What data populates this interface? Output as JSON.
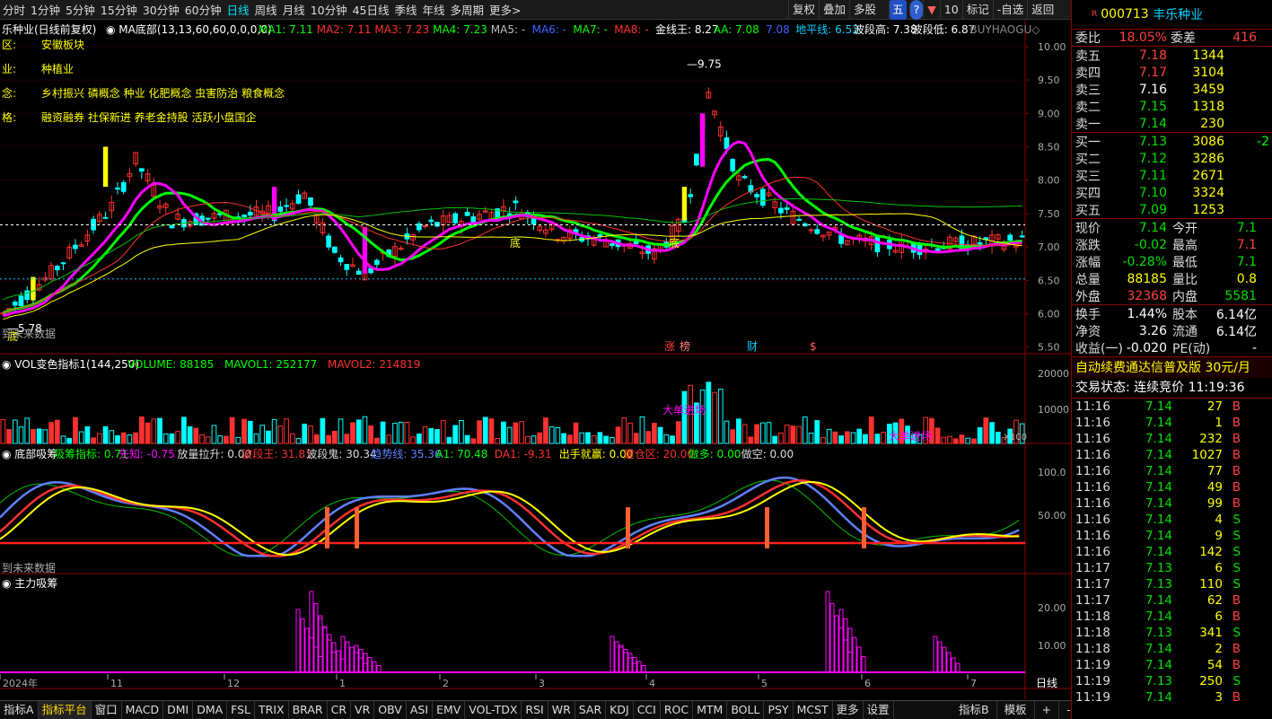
{
  "toolbar": {
    "periods": [
      "分时",
      "1分钟",
      "5分钟",
      "15分钟",
      "30分钟",
      "60分钟",
      "日线",
      "周线",
      "月线",
      "10分钟",
      "45日线",
      "季线",
      "年线",
      "多周期",
      "更多>"
    ],
    "active": "日线",
    "right": [
      "复权",
      "叠加",
      "多股"
    ],
    "num": "10",
    "mark": "标记",
    "self_sel": "-自选",
    "back": "返回"
  },
  "info": {
    "region_k": "区:",
    "region": "安徽板块",
    "industry_k": "业:",
    "industry": "种植业",
    "concept_k": "念:",
    "concept": "乡村振兴 磷概念 种业 化肥概念 虫害防治 粮食概念",
    "style_k": "格:",
    "style": "融资融券 社保新进 养老金持股 活跃小盘国企"
  },
  "main": {
    "title": "乐种业(日线前复权)",
    "ma_title": "MA底部(13,13,60,60,0,0,0,0)",
    "ma": [
      {
        "k": "MA1: 7.11",
        "c": "#00ff00"
      },
      {
        "k": "MA2: 7.11",
        "c": "#ff3030"
      },
      {
        "k": "MA3: 7.23",
        "c": "#ff3030"
      },
      {
        "k": "MA4: 7.23",
        "c": "#00ff00"
      },
      {
        "k": "MA5: -",
        "c": "#c0c0c0"
      },
      {
        "k": "MA6: -",
        "c": "#4060ff"
      },
      {
        "k": "MA7: -",
        "c": "#00ff00"
      },
      {
        "k": "MA8: -",
        "c": "#ff3030"
      },
      {
        "k": "金线王: 8.27",
        "c": "#ffffff"
      },
      {
        "k": "AA: 7.08",
        "c": "#00ff00"
      },
      {
        "k": "7.08",
        "c": "#4060ff"
      },
      {
        "k": "地平线: 6.52",
        "c": "#00d0ff"
      },
      {
        "k": "波段高: 7.38",
        "c": "#fff"
      },
      {
        "k": "波段低: 6.87",
        "c": "#fff"
      },
      {
        "k": "BUYHAOGU◇",
        "c": "#888"
      }
    ],
    "y_labels": [
      "10.00",
      "9.50",
      "9.00",
      "8.50",
      "8.00",
      "7.50",
      "7.00",
      "6.50",
      "6.00",
      "5.50"
    ],
    "high_label": "9.75",
    "low_label": "5.78",
    "future": "到未来数据",
    "di": "底",
    "events": [
      "涨",
      "榜",
      "财",
      "$"
    ]
  },
  "vol": {
    "title": "VOL变色指标1(144,250)",
    "v": "VOLUME: 88185",
    "m1": "MAVOL1: 252177",
    "m2": "MAVOL2: 214819",
    "y": [
      "20000",
      "10000"
    ],
    "x100": "X100",
    "big": "大单进场"
  },
  "ind": {
    "title": "底部吸筹",
    "items": [
      {
        "k": "吸筹指标: 0.71",
        "c": "#00ff00"
      },
      {
        "k": "先知: -0.75",
        "c": "#ff00ff"
      },
      {
        "k": "放量拉升: 0.00",
        "c": "#ddd"
      },
      {
        "k": "波段王: 31.81",
        "c": "#ff3030"
      },
      {
        "k": "波段鬼: 30.34",
        "c": "#ddd"
      },
      {
        "k": "趋势线: 35.36",
        "c": "#6080ff"
      },
      {
        "k": "A1: 70.48",
        "c": "#00ff00"
      },
      {
        "k": "DA1: -9.31",
        "c": "#ff3030"
      },
      {
        "k": "出手就赢: 0.00",
        "c": "#ffff00"
      },
      {
        "k": "建仓区: 20.00",
        "c": "#ff3030"
      },
      {
        "k": "做多: 0.00",
        "c": "#00ff00"
      },
      {
        "k": "做空: 0.00",
        "c": "#ddd"
      }
    ],
    "y": [
      "100.0",
      "50.00"
    ],
    "future": "到未来数据"
  },
  "main_chip": {
    "title": "主力吸筹",
    "y": [
      "20.00",
      "10.00"
    ],
    "x_dates": [
      "2024年",
      "11",
      "12",
      "1",
      "2",
      "3",
      "4",
      "5",
      "6",
      "7"
    ],
    "period": "日线"
  },
  "bottom": {
    "tabs": [
      "指标A",
      "指标平台",
      "窗口",
      "MACD",
      "DMI",
      "DMA",
      "FSL",
      "TRIX",
      "BRAR",
      "CR",
      "VR",
      "OBV",
      "ASI",
      "EMV",
      "VOL-TDX",
      "RSI",
      "WR",
      "SAR",
      "KDJ",
      "CCI",
      "ROC",
      "MTM",
      "BOLL",
      "PSY",
      "MCST",
      "更多",
      "设置"
    ],
    "active": "指标平台",
    "right": [
      "指标B",
      "模板",
      "+",
      "-"
    ]
  },
  "quote": {
    "code": "000713",
    "name": "丰乐种业",
    "wb_k": "委比",
    "wb": "18.05%",
    "wc_k": "委差",
    "wc": "416",
    "asks": [
      {
        "k": "卖五",
        "p": "7.18",
        "v": "1344",
        "pc": "red"
      },
      {
        "k": "卖四",
        "p": "7.17",
        "v": "3104",
        "pc": "red"
      },
      {
        "k": "卖三",
        "p": "7.16",
        "v": "3459",
        "pc": "wht"
      },
      {
        "k": "卖二",
        "p": "7.15",
        "v": "1318",
        "pc": "grn"
      },
      {
        "k": "卖一",
        "p": "7.14",
        "v": "230",
        "pc": "grn"
      }
    ],
    "bids": [
      {
        "k": "买一",
        "p": "7.13",
        "v": "3086",
        "pc": "grn",
        "x": "-2"
      },
      {
        "k": "买二",
        "p": "7.12",
        "v": "3286",
        "pc": "grn",
        "x": ""
      },
      {
        "k": "买三",
        "p": "7.11",
        "v": "2671",
        "pc": "grn",
        "x": ""
      },
      {
        "k": "买四",
        "p": "7.10",
        "v": "3324",
        "pc": "grn",
        "x": ""
      },
      {
        "k": "买五",
        "p": "7.09",
        "v": "1253",
        "pc": "grn",
        "x": ""
      }
    ],
    "stats": [
      {
        "a": "现价",
        "av": "7.14",
        "ac": "grn",
        "b": "今开",
        "bv": "7.1",
        "bc": "grn"
      },
      {
        "a": "涨跌",
        "av": "-0.02",
        "ac": "grn",
        "b": "最高",
        "bv": "7.1",
        "bc": "red"
      },
      {
        "a": "涨幅",
        "av": "-0.28%",
        "ac": "grn",
        "b": "最低",
        "bv": "7.1",
        "bc": "grn"
      },
      {
        "a": "总量",
        "av": "88185",
        "ac": "yel",
        "b": "量比",
        "bv": "0.8",
        "bc": "yel"
      },
      {
        "a": "外盘",
        "av": "32368",
        "ac": "red",
        "b": "内盘",
        "bv": "5581",
        "bc": "grn"
      }
    ],
    "stats2": [
      {
        "a": "换手",
        "av": "1.44%",
        "b": "股本",
        "bv": "6.14亿"
      },
      {
        "a": "净资",
        "av": "3.26",
        "b": "流通",
        "bv": "6.14亿"
      },
      {
        "a": "收益(一)",
        "av": "-0.020",
        "b": "PE(动)",
        "bv": "-"
      }
    ],
    "ad": "自动续费通达信普及版  30元/月",
    "status": "交易状态: 连续竞价 11:19:36",
    "ticks": [
      [
        "11:16",
        "7.14",
        "27",
        "B"
      ],
      [
        "11:16",
        "7.14",
        "1",
        "B"
      ],
      [
        "11:16",
        "7.14",
        "232",
        "B"
      ],
      [
        "11:16",
        "7.14",
        "1027",
        "B"
      ],
      [
        "11:16",
        "7.14",
        "77",
        "B"
      ],
      [
        "11:16",
        "7.14",
        "49",
        "B"
      ],
      [
        "11:16",
        "7.14",
        "99",
        "B"
      ],
      [
        "11:16",
        "7.14",
        "4",
        "S"
      ],
      [
        "11:16",
        "7.14",
        "9",
        "S"
      ],
      [
        "11:16",
        "7.14",
        "142",
        "S"
      ],
      [
        "11:17",
        "7.13",
        "6",
        "S"
      ],
      [
        "11:17",
        "7.13",
        "110",
        "S"
      ],
      [
        "11:17",
        "7.14",
        "62",
        "B"
      ],
      [
        "11:18",
        "7.14",
        "6",
        "B"
      ],
      [
        "11:18",
        "7.13",
        "341",
        "S"
      ],
      [
        "11:18",
        "7.14",
        "2",
        "B"
      ],
      [
        "11:19",
        "7.14",
        "54",
        "B"
      ],
      [
        "11:19",
        "7.13",
        "250",
        "S"
      ],
      [
        "11:19",
        "7.14",
        "3",
        "B"
      ]
    ]
  },
  "colors": {
    "up": "#ff3030",
    "down": "#00ffff",
    "bg": "#000000",
    "grid": "#8b0000"
  }
}
